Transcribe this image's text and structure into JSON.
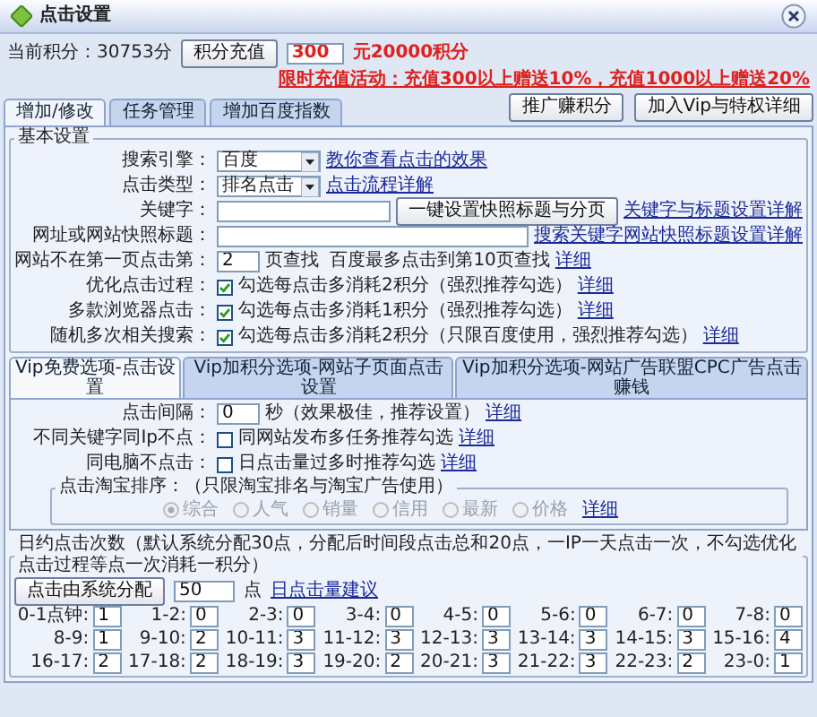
{
  "window": {
    "title": "点击设置"
  },
  "header": {
    "points": "当前积分：30753分",
    "recharge_button": "积分充值",
    "amount": "300",
    "amount_note": "元20000积分",
    "promo": "限时充值活动：充值300以上赠送10%，充值1000以上赠送20%",
    "buttons": [
      "推广赚积分",
      "加入Vip与特权详细"
    ]
  },
  "tabs": [
    {
      "label": "增加/修改",
      "selected": true
    },
    {
      "label": "任务管理",
      "selected": false
    },
    {
      "label": "增加百度指数",
      "selected": false
    }
  ],
  "basic_settings": {
    "legend": "基本设置",
    "rows": [
      {
        "kind": "select",
        "label": "搜索引擎：",
        "value": "百度",
        "link": "教你查看点击的效果"
      },
      {
        "kind": "select",
        "label": "点击类型：",
        "value": "排名点击",
        "link": "点击流程详解"
      },
      {
        "kind": "input",
        "label": "关键字：",
        "button": "一键设置快照标题与分页",
        "link": "关键字与标题设置详解"
      },
      {
        "kind": "input",
        "label": "网址或网站快照标题：",
        "link": "搜索关键字网站快照标题设置详解"
      },
      {
        "kind": "number",
        "label": "网站不在第一页点击第：",
        "value": "2",
        "text": "页查找",
        "note": "百度最多点击到第10页查找",
        "link": "详细"
      },
      {
        "kind": "checkbox",
        "label": "优化点击过程：",
        "checked": true,
        "text": "勾选每点击多消耗2积分（强烈推荐勾选）",
        "link": "详细"
      },
      {
        "kind": "checkbox",
        "label": "多款浏览器点击：",
        "checked": true,
        "text": "勾选每点击多消耗1积分（强烈推荐勾选）",
        "link": "详细"
      },
      {
        "kind": "checkbox",
        "label": "随机多次相关搜索：",
        "checked": true,
        "text": "勾选每点击多消耗2积分（只限百度使用，强烈推荐勾选）",
        "link": "详细"
      }
    ]
  },
  "vip_tabs": [
    {
      "label": "Vip免费选项-点击设置",
      "selected": true
    },
    {
      "label": "Vip加积分选项-网站子页面点击设置",
      "selected": false
    },
    {
      "label": "Vip加积分选项-网站广告联盟CPC广告点击赚钱",
      "selected": false
    }
  ],
  "vip_panel": {
    "rows": [
      {
        "kind": "number",
        "label": "点击间隔：",
        "value": "0",
        "text": "秒（效果极佳，推荐设置）",
        "link": "详细"
      },
      {
        "kind": "checkbox",
        "label": "不同关键字同Ip不点：",
        "checked": false,
        "text": "同网站发布多任务推荐勾选",
        "link": "详细"
      },
      {
        "kind": "checkbox",
        "label": "同电脑不点击：",
        "checked": false,
        "text": "日点击量过多时推荐勾选",
        "link": "详细"
      }
    ],
    "taobao": {
      "legend": "点击淘宝排序：（只限淘宝排名与淘宝广告使用）",
      "disabled": true,
      "options": [
        {
          "label": "综合",
          "selected": true
        },
        {
          "label": "人气",
          "selected": false
        },
        {
          "label": "销量",
          "selected": false
        },
        {
          "label": "信用",
          "selected": false
        },
        {
          "label": "最新",
          "selected": false
        },
        {
          "label": "价格",
          "selected": false
        }
      ],
      "link": "详细"
    }
  },
  "daily_clicks": {
    "legend": "日约点击次数（默认系统分配30点，分配后时间段点击总和20点，一IP一天点击一次，不勾选优化点击过程等点一次消耗一积分）",
    "button": "点击由系统分配",
    "value": "50",
    "unit": "点",
    "link": "日点击量建议",
    "slots": [
      {
        "label": "0-1点钟:",
        "value": "1"
      },
      {
        "label": "1-2:",
        "value": "0"
      },
      {
        "label": "2-3:",
        "value": "0"
      },
      {
        "label": "3-4:",
        "value": "0"
      },
      {
        "label": "4-5:",
        "value": "0"
      },
      {
        "label": "5-6:",
        "value": "0"
      },
      {
        "label": "6-7:",
        "value": "0"
      },
      {
        "label": "7-8:",
        "value": "0"
      },
      {
        "label": "8-9:",
        "value": "1"
      },
      {
        "label": "9-10:",
        "value": "2"
      },
      {
        "label": "10-11:",
        "value": "3"
      },
      {
        "label": "11-12:",
        "value": "3"
      },
      {
        "label": "12-13:",
        "value": "3"
      },
      {
        "label": "13-14:",
        "value": "3"
      },
      {
        "label": "14-15:",
        "value": "3"
      },
      {
        "label": "15-16:",
        "value": "4"
      },
      {
        "label": "16-17:",
        "value": "2"
      },
      {
        "label": "17-18:",
        "value": "2"
      },
      {
        "label": "18-19:",
        "value": "3"
      },
      {
        "label": "19-20:",
        "value": "2"
      },
      {
        "label": "20-21:",
        "value": "3"
      },
      {
        "label": "21-22:",
        "value": "3"
      },
      {
        "label": "22-23:",
        "value": "2"
      },
      {
        "label": "23-0:",
        "value": "1"
      }
    ]
  }
}
